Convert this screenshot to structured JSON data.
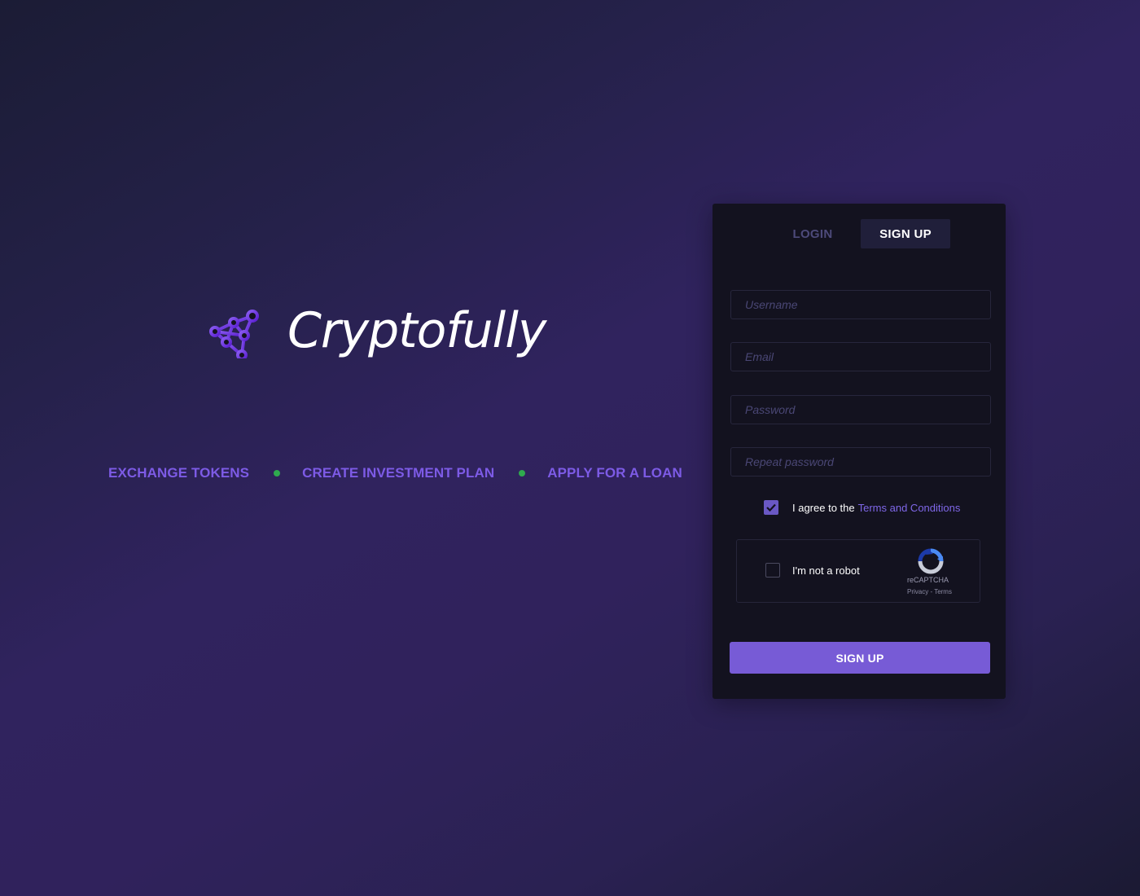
{
  "brand": {
    "name": "Cryptofully",
    "logo_icon": "network-nodes-logo-icon"
  },
  "features": [
    "EXCHANGE TOKENS",
    "CREATE INVESTMENT PLAN",
    "APPLY FOR A LOAN"
  ],
  "tabs": {
    "login": "LOGIN",
    "signup": "SIGN UP",
    "active": "signup"
  },
  "form": {
    "username_placeholder": "Username",
    "email_placeholder": "Email",
    "password_placeholder": "Password",
    "repeat_password_placeholder": "Repeat password",
    "agree_text": "I agree to the",
    "terms_link": "Terms and Conditions",
    "agree_checked": true,
    "submit_label": "SIGN UP"
  },
  "captcha": {
    "label": "I'm not a robot",
    "brand": "reCAPTCHA",
    "links": "Privacy - Terms",
    "checked": false,
    "icon": "recaptcha-icon"
  },
  "colors": {
    "accent": "#775bd6",
    "feature_text": "#7d5be6",
    "feature_dot": "#2faa4e",
    "panel_bg": "#13121f"
  }
}
